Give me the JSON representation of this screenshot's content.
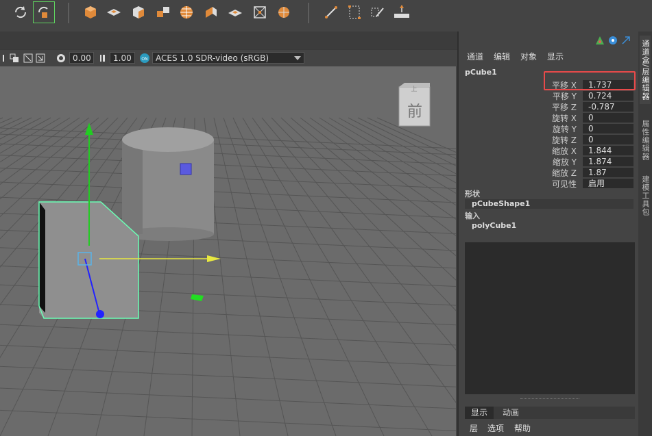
{
  "toolbar": {
    "icons": [
      "snap-rotate-icon",
      "snap-active-icon",
      "create-cube-icon",
      "create-plane-icon",
      "create-box-icon",
      "combine-icon",
      "sphere-icon",
      "extrude-icon",
      "bevel-icon",
      "bridge-icon",
      "grid-object-icon",
      "pen-icon",
      "bounding-box-icon",
      "edit-pen-icon",
      "transform-icon"
    ]
  },
  "viewport_bar": {
    "exposure": "0.00",
    "gamma": "1.00",
    "color_space": "ACES 1.0 SDR-video (sRGB)"
  },
  "viewcube": {
    "label": "前",
    "top_label": "上"
  },
  "channel_box": {
    "menus": [
      "通道",
      "编辑",
      "对象",
      "显示"
    ],
    "object_name": "pCube1",
    "attributes": [
      {
        "label": "平移 X",
        "value": "1.737"
      },
      {
        "label": "平移 Y",
        "value": "0.724"
      },
      {
        "label": "平移 Z",
        "value": "-0.787"
      },
      {
        "label": "旋转 X",
        "value": "0"
      },
      {
        "label": "旋转 Y",
        "value": "0"
      },
      {
        "label": "旋转 Z",
        "value": "0"
      },
      {
        "label": "缩放 X",
        "value": "1.844"
      },
      {
        "label": "缩放 Y",
        "value": "1.874"
      },
      {
        "label": "缩放 Z",
        "value": "1.87"
      },
      {
        "label": "可见性",
        "value": "启用"
      }
    ],
    "shape_section": "形状",
    "shape_node": "pCubeShape1",
    "input_section": "输入",
    "input_node": "polyCube1"
  },
  "layer_editor": {
    "tabs": [
      "显示",
      "动画"
    ],
    "menus": [
      "层",
      "选项",
      "帮助"
    ]
  },
  "side_tabs": [
    "通道盒/层编辑器",
    "属性编辑器",
    "建模工具包"
  ],
  "colors": {
    "highlight": "#e84a4a",
    "selection": "#6bffb5",
    "grid": "#555555"
  }
}
